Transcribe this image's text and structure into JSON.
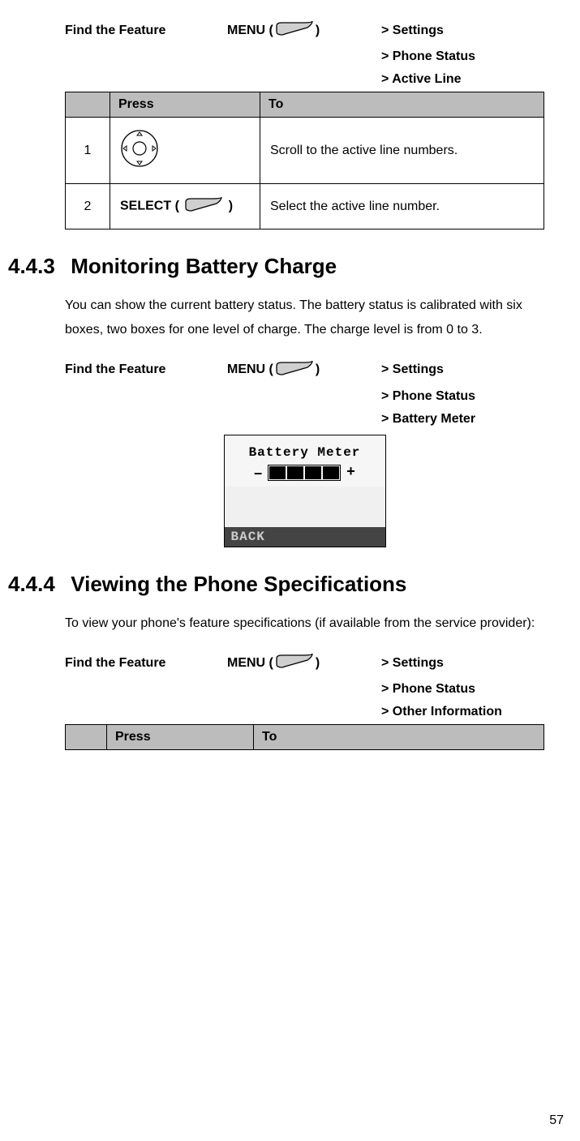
{
  "section1": {
    "find_the_feature": "Find the Feature",
    "menu_label": "MENU (",
    "menu_close": ")",
    "path1": "> Settings",
    "path2": "> Phone Status",
    "path3": "> Active Line",
    "table_head_press": "Press",
    "table_head_to": "To",
    "rows": [
      {
        "num": "1",
        "press": "",
        "to": "Scroll to the active line numbers."
      },
      {
        "num": "2",
        "press_prefix": "SELECT (",
        "press_suffix": ")",
        "to": "Select the active line number."
      }
    ]
  },
  "section2": {
    "number": "4.4.3",
    "title": "Monitoring Battery Charge",
    "para": "You can show the current battery status. The battery status is calibrated with six boxes, two boxes for one level of charge. The charge level is from 0 to 3.",
    "find_the_feature": "Find the Feature",
    "menu_label": "MENU (",
    "menu_close": ")",
    "path1": "> Settings",
    "path2": "> Phone Status",
    "path3": "> Battery Meter",
    "screen": {
      "title": "Battery Meter",
      "minus": "–",
      "plus": "+",
      "back": "BACK"
    }
  },
  "section3": {
    "number": "4.4.4",
    "title": "Viewing the Phone Specifications",
    "para": "To view your phone's feature specifications (if available from the service provider):",
    "find_the_feature": "Find the Feature",
    "menu_label": "MENU (",
    "menu_close": ")",
    "path1": "> Settings",
    "path2": "> Phone Status",
    "path3": "> Other Information",
    "table_head_press": "Press",
    "table_head_to": "To"
  },
  "page_number": "57"
}
